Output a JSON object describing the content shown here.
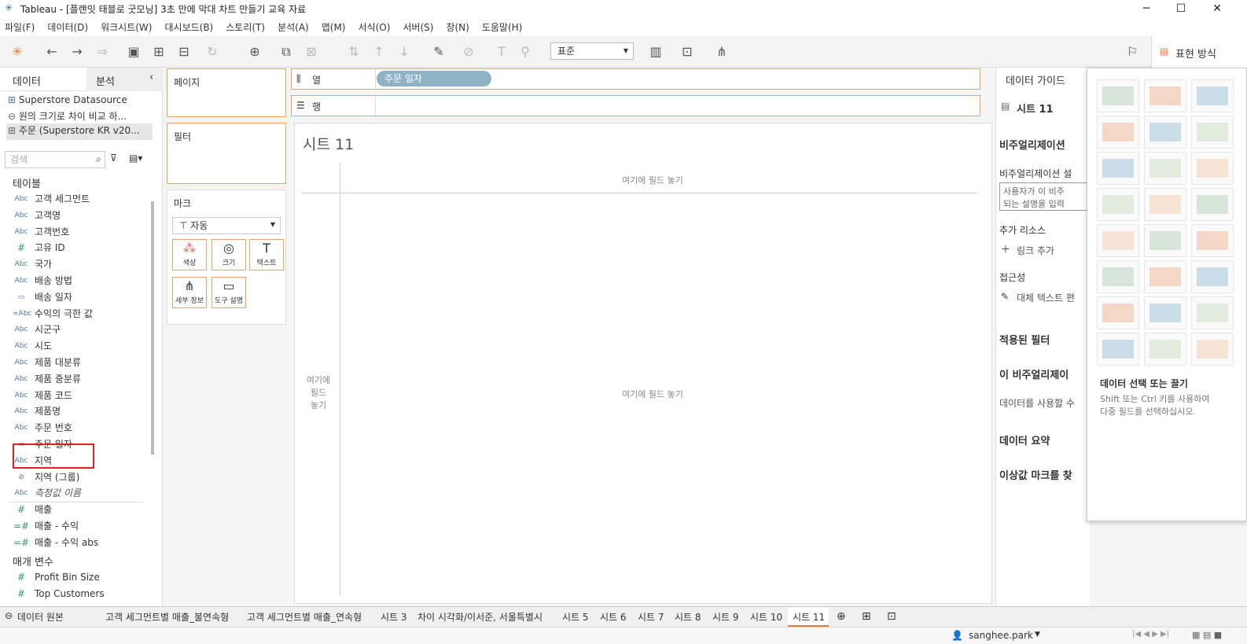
{
  "title": "Tableau - [플랜잇 태블로 굿모닝] 3초 만에 막대 차트 만들기 교육 자료",
  "menu": [
    "파일(F)",
    "데이터(D)",
    "워크시트(W)",
    "대시보드(B)",
    "스토리(T)",
    "분석(A)",
    "맵(M)",
    "서식(O)",
    "서버(S)",
    "창(N)",
    "도움말(H)"
  ],
  "toolbar": {
    "standard": "표준",
    "showme": "표현 방식"
  },
  "left": {
    "tab_data": "데이터",
    "tab_analysis": "분석",
    "sources": [
      "Superstore Datasource",
      "원의 크기로 차이 비교 하...",
      "주문 (Superstore KR v20..."
    ],
    "search": "검색",
    "tables": "테이블",
    "fields": [
      {
        "icon": "Abc",
        "label": "고객 세그먼트"
      },
      {
        "icon": "Abc",
        "label": "고객명"
      },
      {
        "icon": "Abc",
        "label": "고객번호"
      },
      {
        "icon": "#",
        "label": "고유 ID"
      },
      {
        "icon": "Abc",
        "label": "국가"
      },
      {
        "icon": "Abc",
        "label": "배송 방법"
      },
      {
        "icon": "▭",
        "label": "배송 일자"
      },
      {
        "icon": "=Abc",
        "label": "수익의 극한 값"
      },
      {
        "icon": "Abc",
        "label": "시군구"
      },
      {
        "icon": "Abc",
        "label": "시도"
      },
      {
        "icon": "Abc",
        "label": "제품 대분류"
      },
      {
        "icon": "Abc",
        "label": "제품 중분류"
      },
      {
        "icon": "Abc",
        "label": "제품 코드"
      },
      {
        "icon": "Abc",
        "label": "제품명"
      },
      {
        "icon": "Abc",
        "label": "주문 번호"
      },
      {
        "icon": "▭",
        "label": "주문 일자"
      },
      {
        "icon": "Abc",
        "label": "지역"
      },
      {
        "icon": "⊘",
        "label": "지역 (그룹)"
      },
      {
        "icon": "Abc",
        "label": "측정값 이름"
      },
      {
        "icon": "#",
        "label": "매출"
      },
      {
        "icon": "=#",
        "label": "매출 - 수익"
      },
      {
        "icon": "=#",
        "label": "매출 - 수익 abs"
      }
    ],
    "params_title": "매개 변수",
    "params": [
      {
        "icon": "#",
        "label": "Profit Bin Size"
      },
      {
        "icon": "#",
        "label": "Top Customers"
      }
    ]
  },
  "shelves": {
    "pages": "페이지",
    "filters": "필터",
    "marks": "마크",
    "marks_type": "자동",
    "columns": "열",
    "rows": "행",
    "column_pill": "주문 일자",
    "mark_buttons": [
      "색상",
      "크기",
      "텍스트",
      "세부 정보",
      "도구 설명"
    ]
  },
  "viz": {
    "sheet_title": "시트 11",
    "drop_top": "여기에 필드 놓기",
    "drop_center": "여기에 필드 놓기",
    "drop_left": "여기에\n필드\n놓기"
  },
  "right": {
    "header": "데이터 가이드",
    "sheet": "시트 11",
    "viz_title": "비주얼리제이션",
    "viz_desc_label": "비주얼리제이션 설",
    "desc_placeholder": "사용자가 이 비주\n되는 설명을 입력",
    "resources": "추가 리소스",
    "add_link": "링크 추가",
    "access": "접근성",
    "alt_text": "대체 텍스트 편",
    "applied_filters": "적용된 필터",
    "this_viz": "이 비주얼리제이",
    "data_use": "데이터를 사용할 수",
    "data_summary": "데이터 요약",
    "outliers": "이상값 마크를 찾"
  },
  "showme": {
    "hint_title": "데이터 선택 또는 끌기",
    "hint_body": "Shift 또는 Ctrl 키를 사용하여\n다중 필드를 선택하십시오."
  },
  "tabs": [
    "데이터 원본",
    "고객 세그먼트별 매출_불연속형",
    "고객 세그먼트별 매출_연속형",
    "시트 3",
    "차이 시각화/이서준, 서울특별시",
    "시트 5",
    "시트 6",
    "시트 7",
    "시트 8",
    "시트 9",
    "시트 10",
    "시트 11"
  ],
  "status": {
    "user": "sanghee.park"
  }
}
